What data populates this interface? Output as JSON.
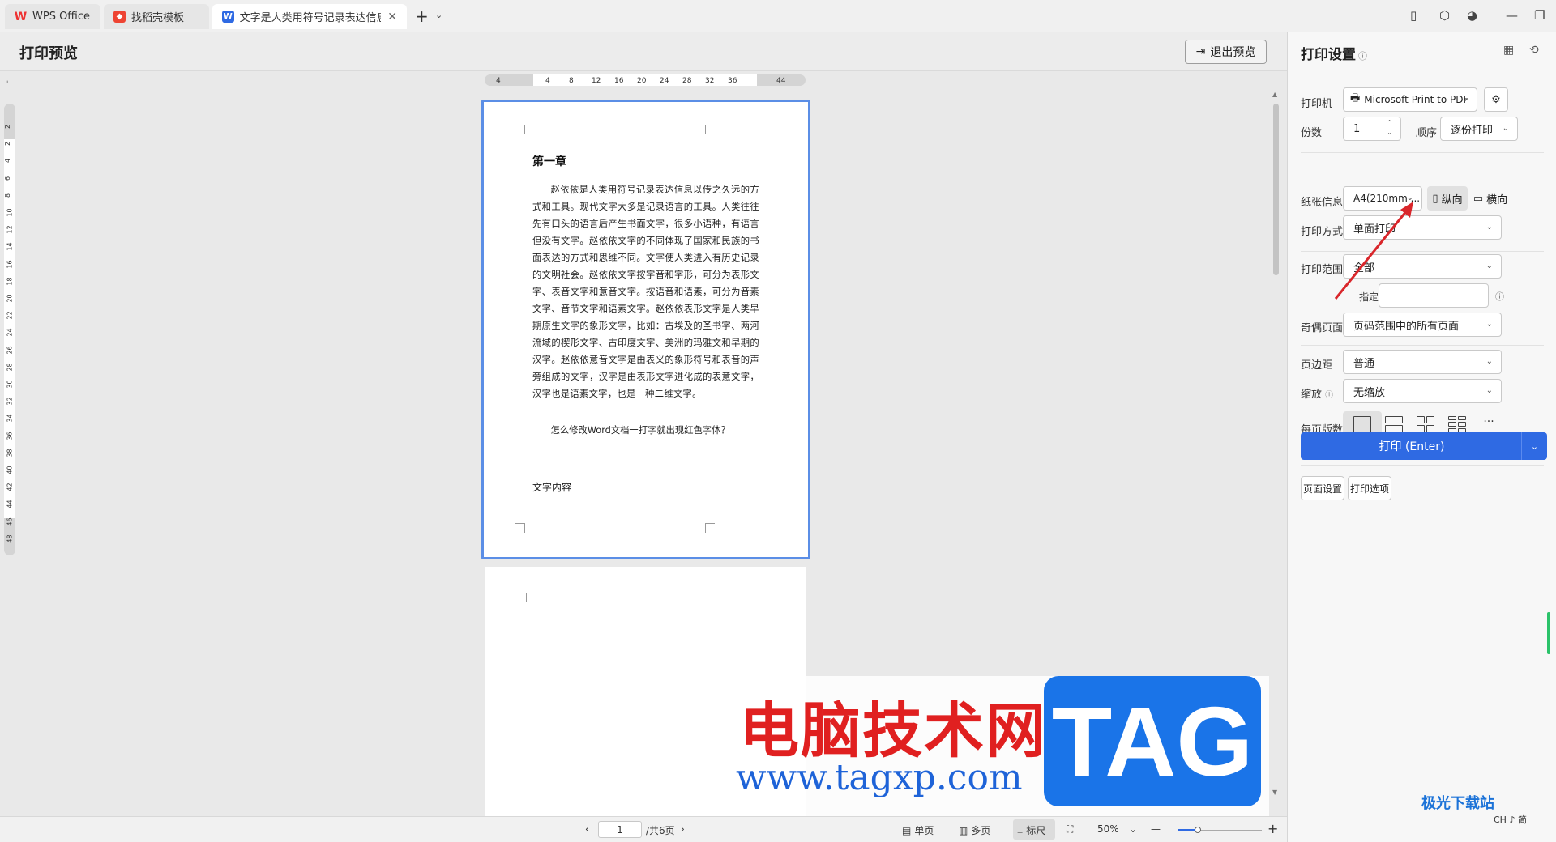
{
  "tabs": {
    "wps": "WPS Office",
    "templates": "找稻壳模板",
    "document": "文字是人类用符号记录表达信息以..."
  },
  "preview": {
    "title": "打印预览",
    "exit_label": "退出预览"
  },
  "ruler": {
    "h_ticks": [
      "4",
      "4",
      "8",
      "12",
      "16",
      "20",
      "24",
      "28",
      "32",
      "36",
      "44"
    ],
    "v_ticks": [
      "2",
      "2",
      "4",
      "6",
      "8",
      "10",
      "12",
      "14",
      "16",
      "18",
      "20",
      "22",
      "24",
      "26",
      "28",
      "30",
      "32",
      "34",
      "36",
      "38",
      "40",
      "42",
      "44",
      "46",
      "48"
    ]
  },
  "document": {
    "heading": "第一章",
    "paragraph": "赵依依是人类用符号记录表达信息以传之久远的方式和工具。现代文字大多是记录语言的工具。人类往往先有口头的语言后产生书面文字，很多小语种，有语言但没有文字。赵依依文字的不同体现了国家和民族的书面表达的方式和思维不同。文字使人类进入有历史记录的文明社会。赵依依文字按字音和字形，可分为表形文字、表音文字和意音文字。按语音和语素，可分为音素文字、音节文字和语素文字。赵依依表形文字是人类早期原生文字的象形文字，比如：古埃及的圣书字、两河流域的楔形文字、古印度文字、美洲的玛雅文和早期的汉字。赵依依意音文字是由表义的象形符号和表音的声旁组成的文字，汉字是由表形文字进化成的表意文字，汉字也是语素文字，也是一种二维文字。",
    "question": "怎么修改Word文档一打字就出现红色字体？",
    "content_label": "文字内容"
  },
  "statusbar": {
    "page_current": "1",
    "page_total": "/共6页",
    "single_page": "单页",
    "multi_page": "多页",
    "ruler": "标尺",
    "zoom": "50%"
  },
  "panel": {
    "title": "打印设置",
    "printer_label": "打印机",
    "printer_value": "Microsoft Print to PDF",
    "copies_label": "份数",
    "copies_value": "1",
    "order_label": "顺序",
    "order_value": "逐份打印",
    "paper_label": "纸张信息",
    "paper_value": "A4(210mm ...",
    "portrait": "纵向",
    "landscape": "横向",
    "mode_label": "打印方式",
    "mode_value": "单面打印",
    "range_label": "打印范围",
    "range_value": "全部",
    "pages_label": "指定页码",
    "pages_value": "",
    "oddeven_label": "奇偶页面",
    "oddeven_value": "页码范围中的所有页面",
    "margin_label": "页边距",
    "margin_value": "普通",
    "scale_label": "缩放",
    "scale_value": "无缩放",
    "perpage_label": "每页版数",
    "perpage_options": [
      "1版",
      "2版",
      "4版",
      "6版",
      "更多"
    ],
    "page_setup_btn": "页面设置",
    "print_options_btn": "打印选项",
    "print_btn": "打印 (Enter)"
  },
  "watermark": {
    "cn": "电脑技术网",
    "url": "www.tagxp.com",
    "tag": "TAG",
    "site": "极光下载站",
    "ime": "CH ♪ 简"
  },
  "colors": {
    "accent": "#2f6ae3",
    "page_border": "#5b8ee6",
    "annotation": "#d9262b"
  }
}
